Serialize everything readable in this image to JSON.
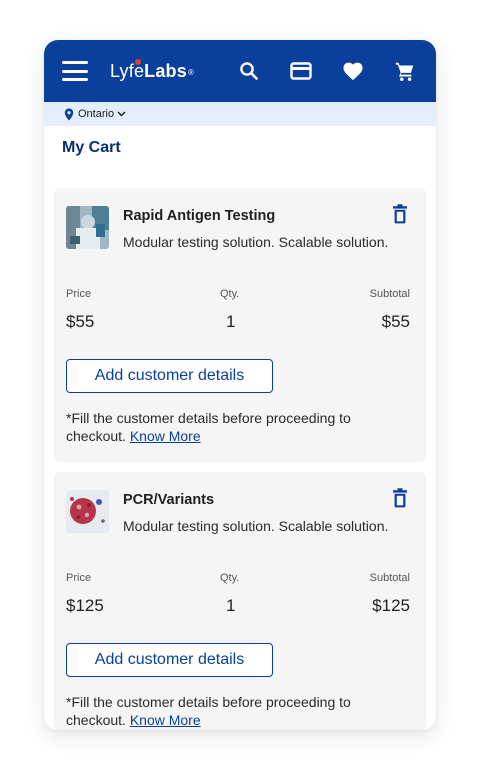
{
  "header": {
    "logo_part1": "Lyfe",
    "logo_part2": "Labs",
    "logo_reg": "®",
    "bg_color": "#0b3f9c",
    "icons": [
      "menu-icon",
      "search-icon",
      "card-icon",
      "heart-icon",
      "cart-icon"
    ]
  },
  "location": {
    "label": "Ontario"
  },
  "page": {
    "title": "My Cart"
  },
  "cart": {
    "labels": {
      "price": "Price",
      "qty": "Qty.",
      "subtotal": "Subtotal"
    },
    "items": [
      {
        "name": "Rapid Antigen Testing",
        "description": "Modular testing solution. Scalable solution.",
        "price": "$55",
        "qty": "1",
        "subtotal": "$55",
        "button_label": "Add customer details",
        "note": "*Fill the customer details before proceeding to checkout.",
        "note_link": "Know More"
      },
      {
        "name": "PCR/Variants",
        "description": "Modular testing solution. Scalable solution.",
        "price": "$125",
        "qty": "1",
        "subtotal": "$125",
        "button_label": "Add customer details",
        "note": "*Fill the customer details before proceeding to checkout.",
        "note_link": "Know More"
      }
    ]
  }
}
